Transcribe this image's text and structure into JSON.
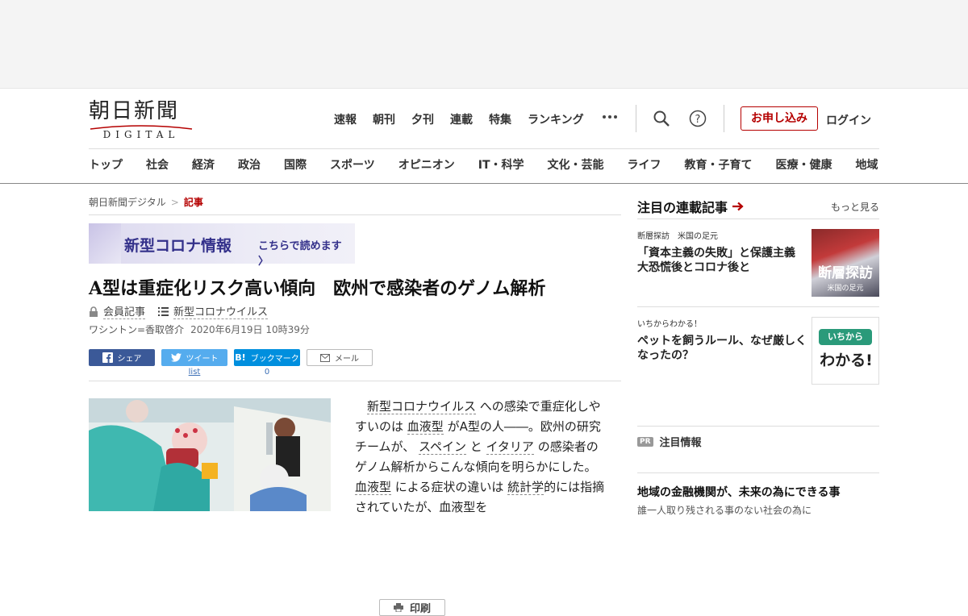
{
  "logo": {
    "jp": "朝日新聞",
    "en": "DIGITAL"
  },
  "topnav": [
    "速報",
    "朝刊",
    "夕刊",
    "連載",
    "特集",
    "ランキング"
  ],
  "header": {
    "apply": "お申し込み",
    "login": "ログイン"
  },
  "catnav": [
    "トップ",
    "社会",
    "経済",
    "政治",
    "国際",
    "スポーツ",
    "オピニオン",
    "IT・科学",
    "文化・芸能",
    "ライフ",
    "教育・子育て",
    "医療・健康",
    "地域"
  ],
  "breadcrumb": {
    "home": "朝日新聞デジタル",
    "sep": ">",
    "current": "記事"
  },
  "banner": {
    "title": "新型コロナ情報",
    "link": "こちらで読めます"
  },
  "article": {
    "headline": "A型は重症化リスク高い傾向　欧州で感染者のゲノム解析",
    "member": "会員記事",
    "topic": "新型コロナウイルス",
    "byline": "ワシントン=香取啓介",
    "date": "2020年6月19日 10時39分",
    "body": [
      {
        "t": "新型コロナウイルス",
        "link": true
      },
      {
        "t": " への感染で重症化しやすいのは ",
        "link": false
      },
      {
        "t": "血液型",
        "link": true
      },
      {
        "t": " がA型の人――。欧州の研究チームが、 ",
        "link": false
      },
      {
        "t": "スペイン",
        "link": true
      },
      {
        "t": " と ",
        "link": false
      },
      {
        "t": "イタリア",
        "link": true
      },
      {
        "t": " の感染者のゲノム解析からこんな傾向を明らかにした。 ",
        "link": false
      },
      {
        "t": "血液型",
        "link": true
      },
      {
        "t": " による症状の違いは ",
        "link": false
      },
      {
        "t": "統計学",
        "link": true
      },
      {
        "t": "的には指摘されていたが、血液型を",
        "link": false
      }
    ]
  },
  "share": {
    "facebook": "シェア",
    "twitter": "ツイート",
    "twitter_count": "list",
    "hatena": "ブックマーク",
    "hatena_count": "0",
    "mail": "メール",
    "print": "印刷"
  },
  "sidebar": {
    "title": "注目の連載記事",
    "more": "もっと見る",
    "items": [
      {
        "cat": "断層探訪　米国の足元",
        "title": "「資本主義の失敗」と保護主義　大恐慌後とコロナ後と",
        "thumb": "断層探訪",
        "thumb_sub": "米国の足元"
      },
      {
        "cat": "いちからわかる！",
        "title": "ペットを飼うルール、なぜ厳しくなったの？",
        "thumb": "いちから",
        "thumb_sub": "わかる!"
      }
    ],
    "pr_tag": "PR",
    "pr_title": "注目情報",
    "ad_title": "地域の金融機関が、未来の為にできる事",
    "ad_sub": "誰一人取り残される事のない社会の為に"
  },
  "colors": {
    "accent": "#b50000",
    "facebook": "#3b5998",
    "twitter": "#55acee",
    "hatena": "#008fde"
  }
}
